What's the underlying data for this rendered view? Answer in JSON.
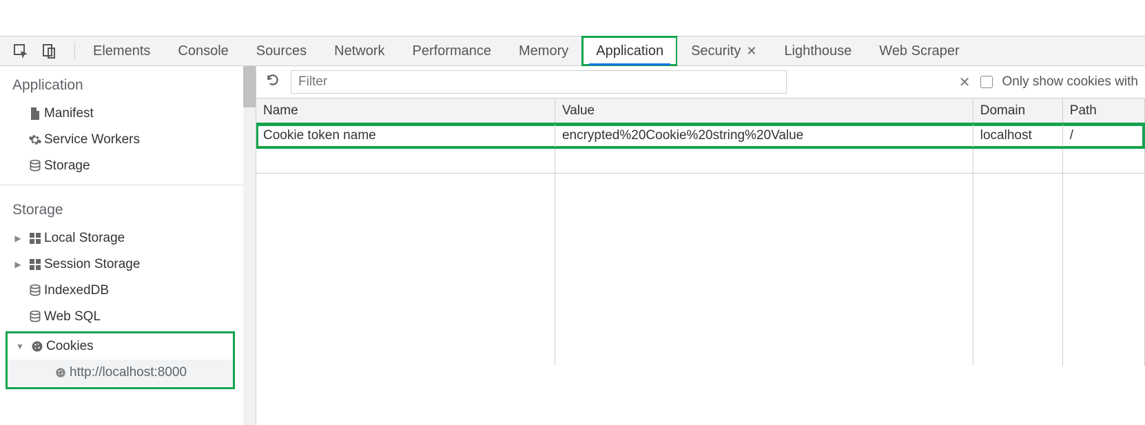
{
  "tabs": {
    "items": [
      "Elements",
      "Console",
      "Sources",
      "Network",
      "Performance",
      "Memory",
      "Application",
      "Security",
      "Lighthouse",
      "Web Scraper"
    ],
    "active": "Application",
    "closable": "Security"
  },
  "sidebar": {
    "section_application_title": "Application",
    "app_items": {
      "manifest": "Manifest",
      "service_workers": "Service Workers",
      "storage": "Storage"
    },
    "section_storage_title": "Storage",
    "storage_items": {
      "local_storage": "Local Storage",
      "session_storage": "Session Storage",
      "indexeddb": "IndexedDB",
      "web_sql": "Web SQL",
      "cookies": "Cookies",
      "cookies_child": "http://localhost:8000"
    }
  },
  "toolbar": {
    "filter_placeholder": "Filter",
    "only_show_label": "Only show cookies with"
  },
  "table": {
    "headers": {
      "name": "Name",
      "value": "Value",
      "domain": "Domain",
      "path": "Path"
    },
    "rows": [
      {
        "name": "Cookie token name",
        "value": "encrypted%20Cookie%20string%20Value",
        "domain": "localhost",
        "path": "/"
      }
    ]
  }
}
